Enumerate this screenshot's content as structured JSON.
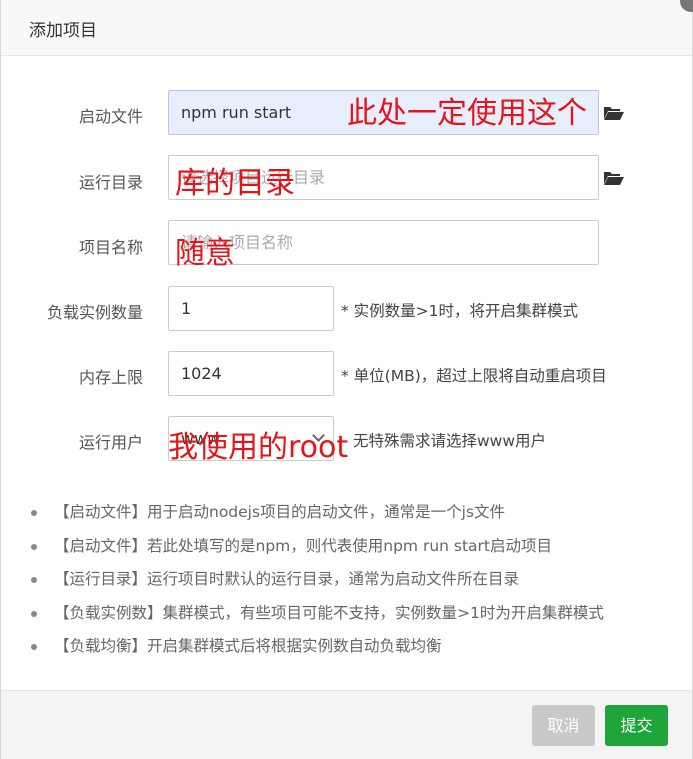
{
  "dialog": {
    "title": "添加项目",
    "cancel_label": "取消",
    "submit_label": "提交"
  },
  "form": {
    "start_file": {
      "label": "启动文件",
      "value": "npm run start"
    },
    "run_dir": {
      "label": "运行目录",
      "placeholder": "请选择项目运行目录"
    },
    "project_name": {
      "label": "项目名称",
      "placeholder": "请输入项目名称"
    },
    "instances": {
      "label": "负载实例数量",
      "value": "1",
      "hint": "* 实例数量>1时，将开启集群模式"
    },
    "memory": {
      "label": "内存上限",
      "value": "1024",
      "hint": "* 单位(MB)，超过上限将自动重启项目"
    },
    "run_user": {
      "label": "运行用户",
      "value": "www",
      "hint": "无特殊需求请选择www用户"
    }
  },
  "annotations": {
    "start_file_note": "此处一定使用这个",
    "run_dir_note": "库的目录",
    "project_name_note": "随意",
    "run_user_note": "我使用的root",
    "color": "#e4151a"
  },
  "tips": [
    "【启动文件】用于启动nodejs项目的启动文件，通常是一个js文件",
    "【启动文件】若此处填写的是npm，则代表使用npm run start启动项目",
    "【运行目录】运行项目时默认的运行目录，通常为启动文件所在目录",
    "【负载实例数】集群模式，有些项目可能不支持，实例数量>1时为开启集群模式",
    "【负载均衡】开启集群模式后将根据实例数自动负载均衡"
  ],
  "icons": {
    "folder": "folder-open-icon",
    "close": "close-icon",
    "dropdown": "chevron-down-icon"
  },
  "colors": {
    "submit_green": "#20a53a",
    "cancel_gray": "#c9c9c9",
    "start_file_bg": "#e8eefb"
  }
}
